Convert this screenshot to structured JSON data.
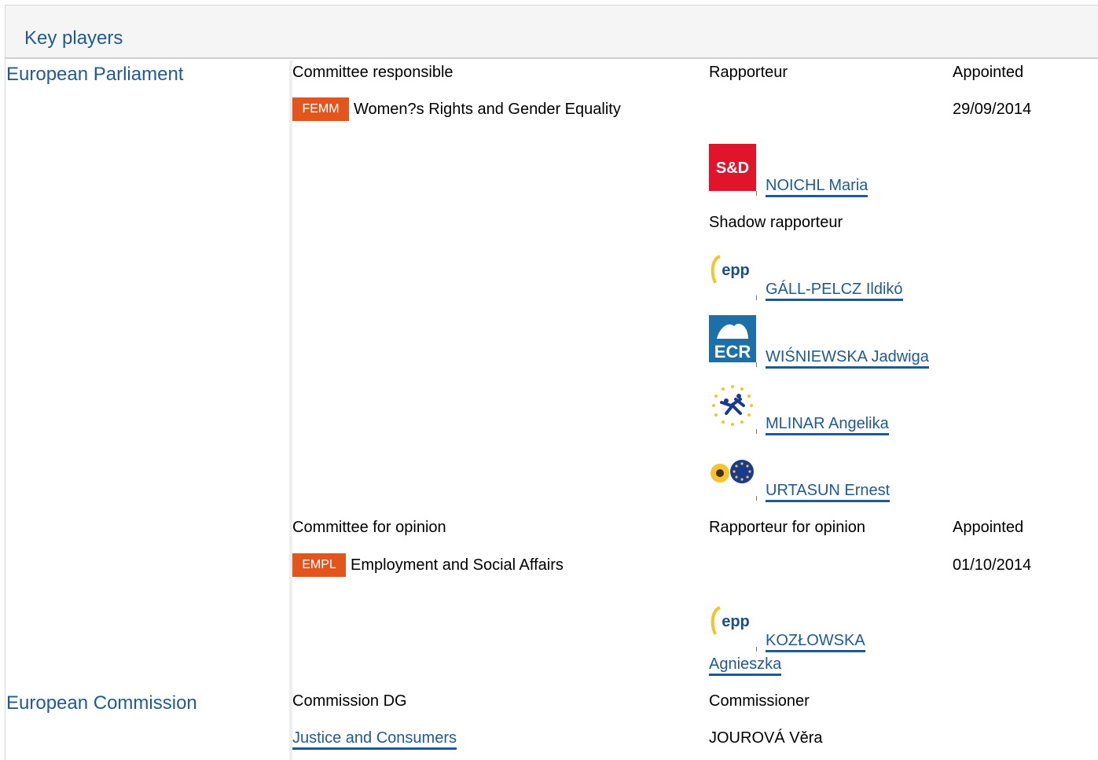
{
  "header": {
    "title": "Key players"
  },
  "parliament": {
    "institution": "European Parliament",
    "committee_responsible": {
      "col_committee": "Committee responsible",
      "col_rapporteur": "Rapporteur",
      "col_appointed": "Appointed",
      "badge": "FEMM",
      "committee_name": "Women?s Rights and Gender Equality",
      "appointed_date": "29/09/2014",
      "rapporteur": {
        "group": "S&D",
        "name": "NOICHL Maria"
      },
      "shadow_label": "Shadow rapporteur",
      "shadows": [
        {
          "group": "epp",
          "name": "GÁLL-PELCZ Ildikó"
        },
        {
          "group": "ECR",
          "name": "WIŚNIEWSKA Jadwiga"
        },
        {
          "group": "ALDE",
          "name": "MLINAR Angelika"
        },
        {
          "group": "Greens/EFA",
          "name": "URTASUN Ernest"
        }
      ]
    },
    "committee_opinion": {
      "col_committee": "Committee for opinion",
      "col_rapporteur": "Rapporteur for opinion",
      "col_appointed": "Appointed",
      "badge": "EMPL",
      "committee_name": "Employment and Social Affairs",
      "appointed_date": "01/10/2014",
      "rapporteur": {
        "group": "epp",
        "name_line1": "KOZŁOWSKA",
        "name_line2": "Agnieszka"
      }
    }
  },
  "commission": {
    "institution": "European Commission",
    "col_dg": "Commission DG",
    "col_commissioner": "Commissioner",
    "dg": "Justice and Consumers",
    "commissioner": "JOUROVÁ Věra"
  },
  "colors": {
    "link": "#1f5a95",
    "badge": "#e2561d",
    "header_bg": "#f5f5f5"
  }
}
